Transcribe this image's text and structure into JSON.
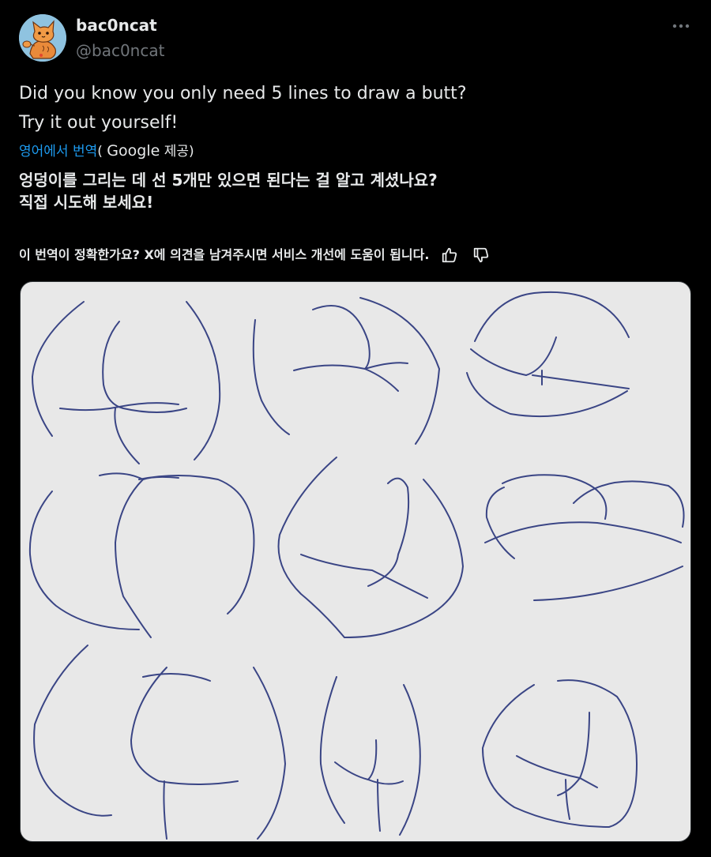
{
  "author": {
    "display_name": "bac0ncat",
    "handle": "@bac0ncat",
    "avatar_icon": "cat-avatar-icon",
    "avatar_color": "#8fc3e0"
  },
  "tweet": {
    "lines": [
      "Did you know you only need 5 lines to draw a butt?",
      "Try it out yourself!"
    ]
  },
  "translation": {
    "link_label": "영어에서 번역",
    "provider_prefix": "(",
    "provider_name": "Google",
    "provider_suffix": " 제공)",
    "lines": [
      "엉덩이를 그리는 데 선 5개만 있으면 된다는 걸 알고 계셨나요?",
      "직접 시도해 보세요!"
    ],
    "feedback_prompt": "이 번역이 정확한가요? X에 의견을 남겨주시면 서비스 개선에 도움이 됩니다."
  },
  "colors": {
    "background": "#000000",
    "text": "#e7e9ea",
    "secondary_text": "#71767b",
    "link": "#1d9bf0",
    "media_background": "#e8e8e8",
    "sketch_stroke": "#3a4585"
  },
  "icons": {
    "more": "more-horizontal-icon",
    "thumbs_up": "thumbs-up-icon",
    "thumbs_down": "thumbs-down-icon"
  }
}
